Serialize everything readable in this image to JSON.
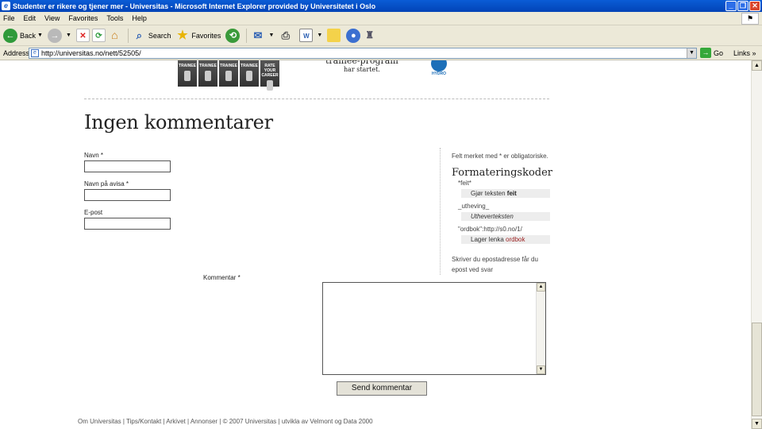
{
  "window": {
    "title": "Studenter er rikere og tjener mer - Universitas - Microsoft Internet Explorer provided by Universitetet i Oslo",
    "btn_min": "_",
    "btn_max": "❐",
    "btn_close": "✕"
  },
  "menu": {
    "items": [
      "File",
      "Edit",
      "View",
      "Favorites",
      "Tools",
      "Help"
    ]
  },
  "toolbar": {
    "back": "Back",
    "search": "Search",
    "favorites": "Favorites"
  },
  "address": {
    "label": "Address",
    "url": "http://universitas.no/nett/52505/",
    "go": "Go",
    "links": "Links"
  },
  "banner": {
    "trainee_labels": [
      "TRAINEE",
      "TRAINEE",
      "TRAINEE",
      "TRAINEE",
      "RATE YOUR CAREER"
    ],
    "line2": "trainee-program",
    "line3": "har startet.",
    "hydro": "HYDRO"
  },
  "page": {
    "heading": "Ingen kommentarer",
    "form": {
      "name_label": "Navn *",
      "newspaper_name_label": "Navn på avisa *",
      "email_label": "E-post",
      "comment_label": "Kommentar *",
      "submit_label": "Send kommentar"
    },
    "aside": {
      "required_note": "Felt merket med * er obligatoriske.",
      "title": "Formateringskoder",
      "bold_code": "*feit*",
      "bold_example_prefix": "Gjør teksten ",
      "bold_example_word": "feit",
      "italic_code": "_utheving_",
      "italic_example": "Utheverteksten",
      "link_code": "\"ordbok\":http://s0.no/1/",
      "link_example_prefix": "Lager lenka ",
      "link_example_word": "ordbok",
      "email_tip": "Skriver du epostadresse får du epost ved svar"
    },
    "footer": "Om Universitas | Tips/Kontakt | Arkivet | Annonser | © 2007 Universitas  |   utvikla av Velmont og Data 2000"
  }
}
